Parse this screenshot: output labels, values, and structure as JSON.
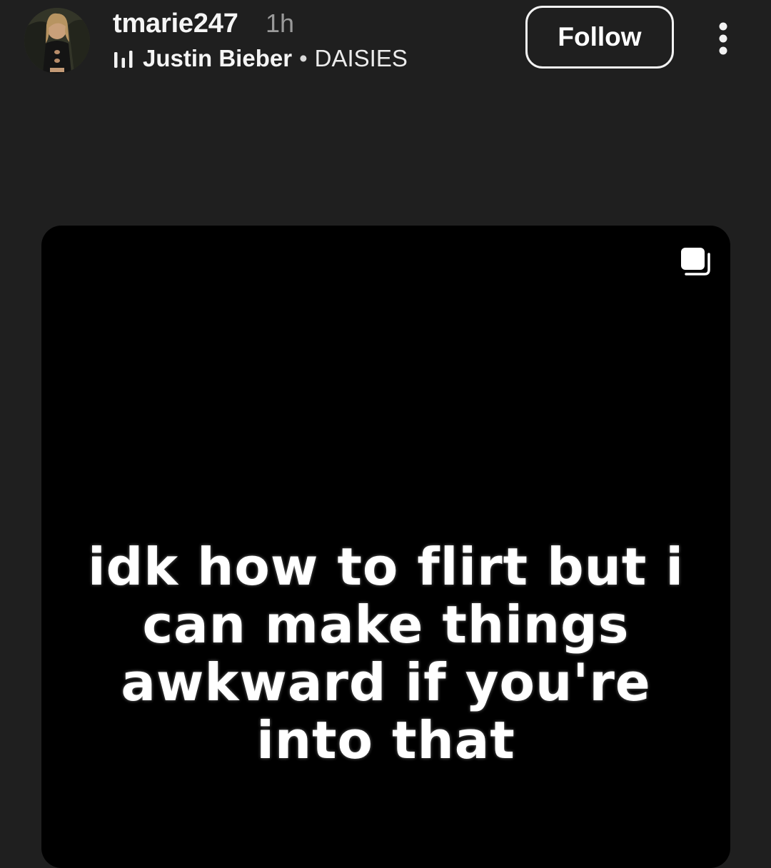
{
  "post": {
    "username": "tmarie247",
    "time_ago": "1h",
    "music": {
      "artist": "Justin Bieber",
      "separator": "•",
      "song": "DAISIES"
    },
    "follow_label": "Follow",
    "caption": "idk how to flirt but i can make things awkward if you're into that"
  },
  "icons": {
    "music": "music-bars-icon",
    "more": "more-vertical-icon",
    "carousel": "multiple-images-icon"
  },
  "colors": {
    "background": "#1f1f1f",
    "card": "#000000",
    "text": "#f5f5f5",
    "muted": "#9a9a9a"
  }
}
